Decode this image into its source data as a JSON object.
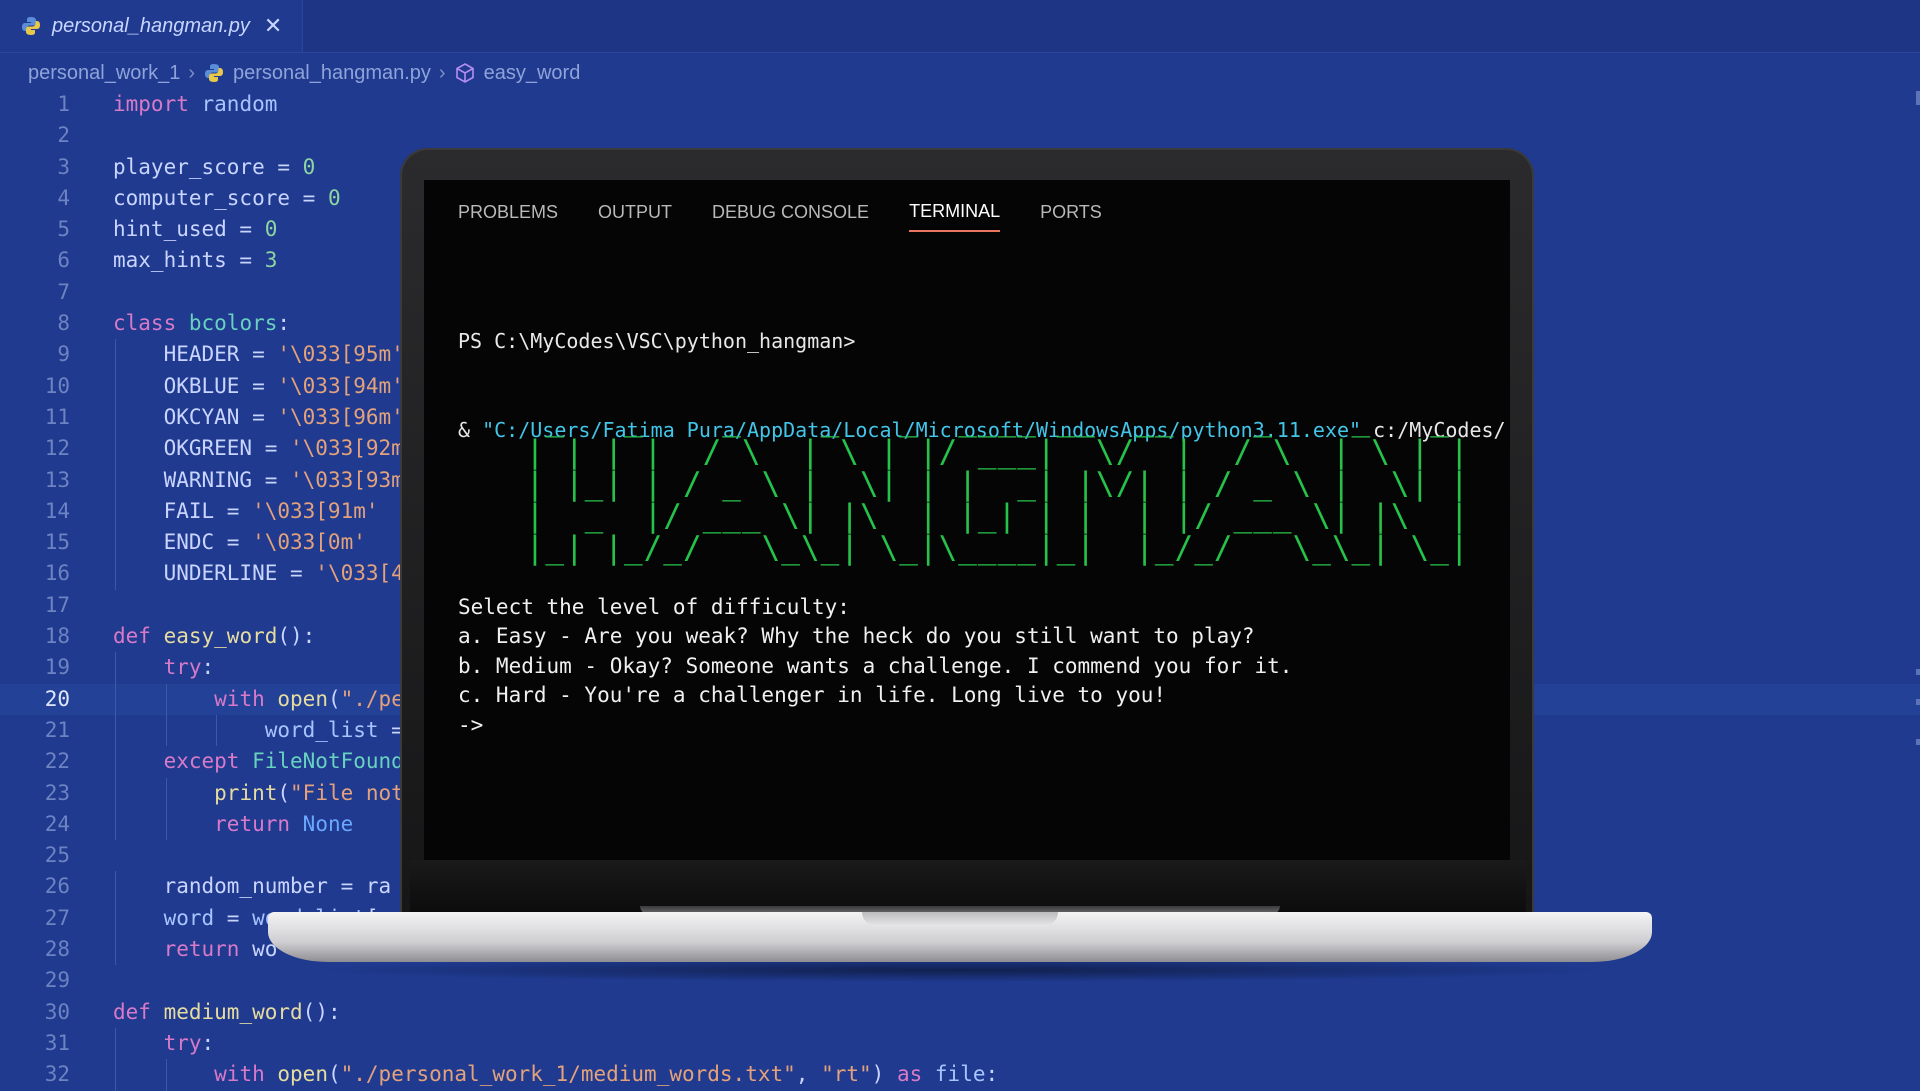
{
  "editor": {
    "tab": {
      "label": "personal_hangman.py",
      "close": "✕"
    },
    "breadcrumb": [
      "personal_work_1",
      "personal_hangman.py",
      "easy_word"
    ],
    "active_line": 20,
    "lines": [
      {
        "n": "1",
        "t": "import random"
      },
      {
        "n": "2",
        "t": ""
      },
      {
        "n": "3",
        "t": "player_score = 0"
      },
      {
        "n": "4",
        "t": "computer_score = 0"
      },
      {
        "n": "5",
        "t": "hint_used = 0"
      },
      {
        "n": "6",
        "t": "max_hints = 3"
      },
      {
        "n": "7",
        "t": ""
      },
      {
        "n": "8",
        "t": "class bcolors:"
      },
      {
        "n": "9",
        "t": "    HEADER = '\\033[95m'"
      },
      {
        "n": "10",
        "t": "    OKBLUE = '\\033[94m'"
      },
      {
        "n": "11",
        "t": "    OKCYAN = '\\033[96m'"
      },
      {
        "n": "12",
        "t": "    OKGREEN = '\\033[92m'"
      },
      {
        "n": "13",
        "t": "    WARNING = '\\033[93m'"
      },
      {
        "n": "14",
        "t": "    FAIL = '\\033[91m'"
      },
      {
        "n": "15",
        "t": "    ENDC = '\\033[0m'"
      },
      {
        "n": "16",
        "t": "    UNDERLINE = '\\033[4m'"
      },
      {
        "n": "17",
        "t": ""
      },
      {
        "n": "18",
        "t": "def easy_word():"
      },
      {
        "n": "19",
        "t": "    try:"
      },
      {
        "n": "20",
        "t": "        with open(\"./pe"
      },
      {
        "n": "21",
        "t": "            word_list ="
      },
      {
        "n": "22",
        "t": "    except FileNotFound"
      },
      {
        "n": "23",
        "t": "        print(\"File not"
      },
      {
        "n": "24",
        "t": "        return None"
      },
      {
        "n": "25",
        "t": ""
      },
      {
        "n": "26",
        "t": "    random_number = ra"
      },
      {
        "n": "27",
        "t": "    word = word_list[r"
      },
      {
        "n": "28",
        "t": "    return wo"
      },
      {
        "n": "29",
        "t": ""
      },
      {
        "n": "30",
        "t": "def medium_word():"
      },
      {
        "n": "31",
        "t": "    try:"
      },
      {
        "n": "32",
        "t": "        with open(\"./personal_work_1/medium_words.txt\", \"rt\") as file:"
      }
    ]
  },
  "terminal": {
    "tabs": [
      "PROBLEMS",
      "OUTPUT",
      "DEBUG CONSOLE",
      "TERMINAL",
      "PORTS"
    ],
    "active_tab": "TERMINAL",
    "prompt": "PS C:\\MyCodes\\VSC\\python_hangman>",
    "command_prefix": "& ",
    "command_exe": "\"C:/Users/Fatima Pura/AppData/Local/Microsoft/WindowsApps/python3.11.exe\"",
    "command_arg": " c:/MyCodes/",
    "banner": [
      "  _   _    _    _   _  ____ __  __    _    _   _ ",
      " | | | |  / \\  | \\ | |/ ___|  \\/  |  / \\  | \\ | |",
      " | |_| | / _ \\ |  \\| | |  _| |\\/| | / _ \\ |  \\| |",
      " |  _  |/ ___ \\| |\\  | |_| | |  | |/ ___ \\| |\\  |",
      " |_| |_/_/   \\_\\_| \\_|\\____|_|  |_/_/   \\_\\_| \\_|"
    ],
    "menu": [
      "Select the level of difficulty:",
      "a. Easy - Are you weak? Why the heck do you still want to play?",
      "b. Medium - Okay? Someone wants a challenge. I commend you for it.",
      "c. Hard - You're a challenger in life. Long live to you!",
      "->"
    ]
  }
}
